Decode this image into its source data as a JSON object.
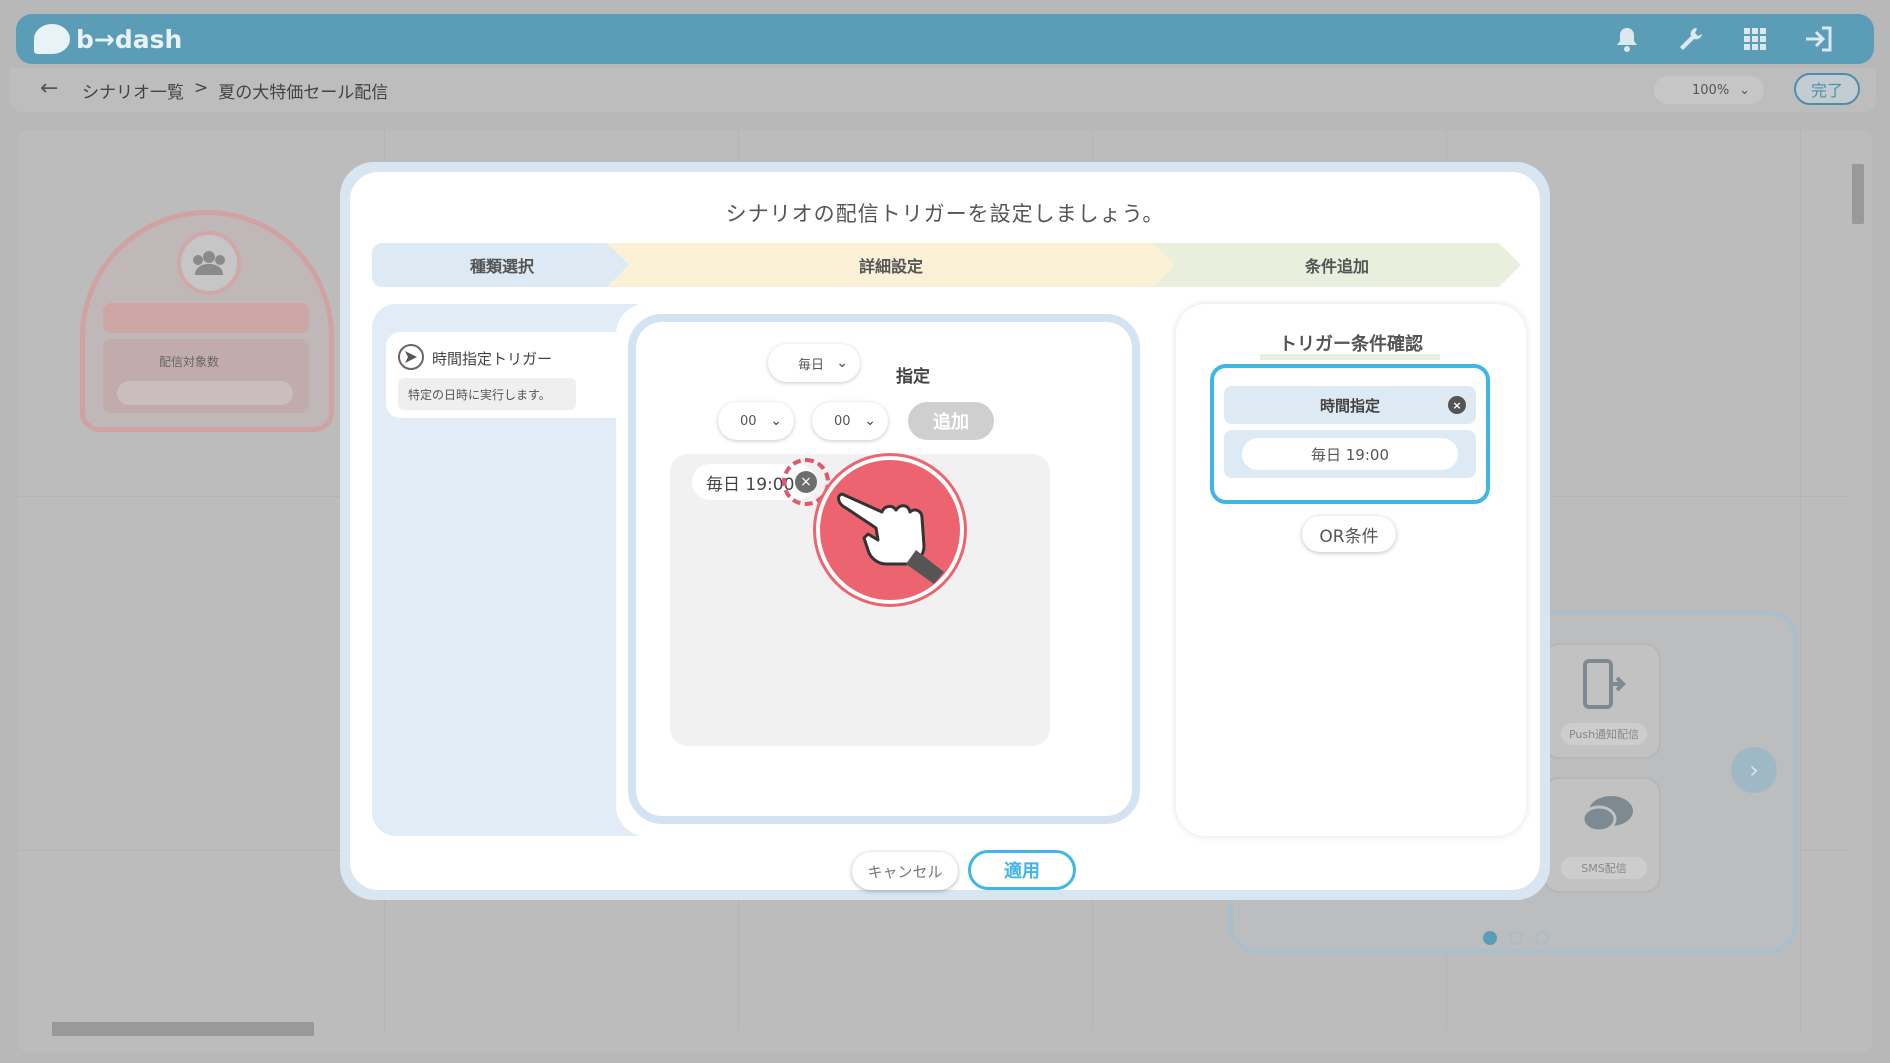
{
  "app": {
    "logo_text": "b→dash"
  },
  "header": {
    "icons": [
      "bell-icon",
      "wrench-icon",
      "grid-icon",
      "logout-icon"
    ],
    "back_glyph": "←",
    "breadcrumb": [
      "シナリオ一覧",
      ">",
      "夏の大特価セール配信"
    ],
    "zoom_value": "100%",
    "done_label": "完了"
  },
  "canvas": {
    "start_node_label": "配信対象数",
    "tiles": [
      "Push通知配信",
      "SMS配信"
    ]
  },
  "modal": {
    "title": "シナリオの配信トリガーを設定しましょう。",
    "steps": [
      "種類選択",
      "詳細設定",
      "条件追加"
    ],
    "trigger": {
      "title": "時間指定トリガー",
      "description": "特定の日時に実行します。"
    },
    "detail": {
      "frequency_value": "毎日",
      "shitei_label": "指定",
      "hour_value": "00",
      "colon": ":",
      "minute_value": "00",
      "add_label": "追加",
      "entries": [
        "毎日 19:00"
      ]
    },
    "summary": {
      "title": "トリガー条件確認",
      "condition_head": "時間指定",
      "condition_value": "毎日 19:00",
      "or_label": "OR条件"
    },
    "cancel_label": "キャンセル",
    "apply_label": "適用"
  },
  "colors": {
    "accent": "#3fb6e6",
    "header_bar": "#5b9cb6",
    "highlight": "#ec6470"
  }
}
